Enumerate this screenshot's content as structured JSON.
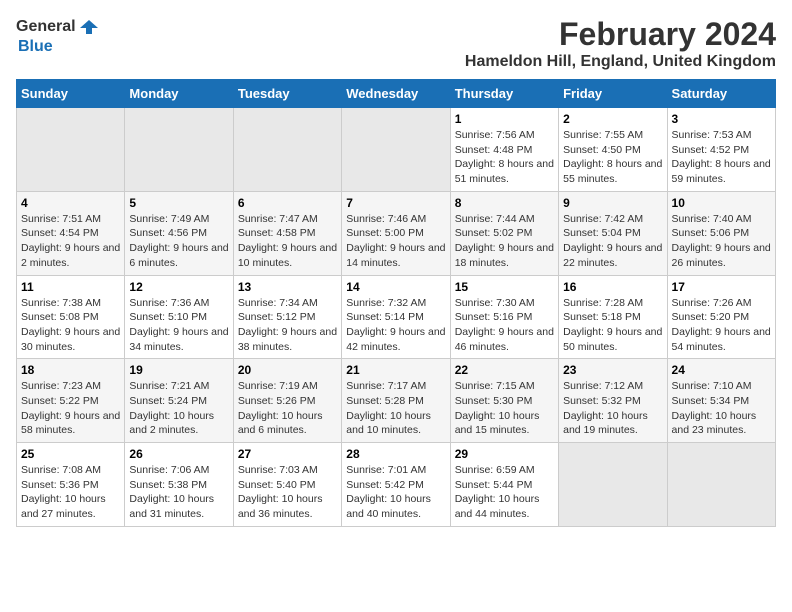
{
  "logo": {
    "general": "General",
    "blue": "Blue"
  },
  "title": "February 2024",
  "subtitle": "Hameldon Hill, England, United Kingdom",
  "days_of_week": [
    "Sunday",
    "Monday",
    "Tuesday",
    "Wednesday",
    "Thursday",
    "Friday",
    "Saturday"
  ],
  "weeks": [
    [
      {
        "day": null,
        "sunrise": null,
        "sunset": null,
        "daylight": null
      },
      {
        "day": null,
        "sunrise": null,
        "sunset": null,
        "daylight": null
      },
      {
        "day": null,
        "sunrise": null,
        "sunset": null,
        "daylight": null
      },
      {
        "day": null,
        "sunrise": null,
        "sunset": null,
        "daylight": null
      },
      {
        "day": "1",
        "sunrise": "Sunrise: 7:56 AM",
        "sunset": "Sunset: 4:48 PM",
        "daylight": "Daylight: 8 hours and 51 minutes."
      },
      {
        "day": "2",
        "sunrise": "Sunrise: 7:55 AM",
        "sunset": "Sunset: 4:50 PM",
        "daylight": "Daylight: 8 hours and 55 minutes."
      },
      {
        "day": "3",
        "sunrise": "Sunrise: 7:53 AM",
        "sunset": "Sunset: 4:52 PM",
        "daylight": "Daylight: 8 hours and 59 minutes."
      }
    ],
    [
      {
        "day": "4",
        "sunrise": "Sunrise: 7:51 AM",
        "sunset": "Sunset: 4:54 PM",
        "daylight": "Daylight: 9 hours and 2 minutes."
      },
      {
        "day": "5",
        "sunrise": "Sunrise: 7:49 AM",
        "sunset": "Sunset: 4:56 PM",
        "daylight": "Daylight: 9 hours and 6 minutes."
      },
      {
        "day": "6",
        "sunrise": "Sunrise: 7:47 AM",
        "sunset": "Sunset: 4:58 PM",
        "daylight": "Daylight: 9 hours and 10 minutes."
      },
      {
        "day": "7",
        "sunrise": "Sunrise: 7:46 AM",
        "sunset": "Sunset: 5:00 PM",
        "daylight": "Daylight: 9 hours and 14 minutes."
      },
      {
        "day": "8",
        "sunrise": "Sunrise: 7:44 AM",
        "sunset": "Sunset: 5:02 PM",
        "daylight": "Daylight: 9 hours and 18 minutes."
      },
      {
        "day": "9",
        "sunrise": "Sunrise: 7:42 AM",
        "sunset": "Sunset: 5:04 PM",
        "daylight": "Daylight: 9 hours and 22 minutes."
      },
      {
        "day": "10",
        "sunrise": "Sunrise: 7:40 AM",
        "sunset": "Sunset: 5:06 PM",
        "daylight": "Daylight: 9 hours and 26 minutes."
      }
    ],
    [
      {
        "day": "11",
        "sunrise": "Sunrise: 7:38 AM",
        "sunset": "Sunset: 5:08 PM",
        "daylight": "Daylight: 9 hours and 30 minutes."
      },
      {
        "day": "12",
        "sunrise": "Sunrise: 7:36 AM",
        "sunset": "Sunset: 5:10 PM",
        "daylight": "Daylight: 9 hours and 34 minutes."
      },
      {
        "day": "13",
        "sunrise": "Sunrise: 7:34 AM",
        "sunset": "Sunset: 5:12 PM",
        "daylight": "Daylight: 9 hours and 38 minutes."
      },
      {
        "day": "14",
        "sunrise": "Sunrise: 7:32 AM",
        "sunset": "Sunset: 5:14 PM",
        "daylight": "Daylight: 9 hours and 42 minutes."
      },
      {
        "day": "15",
        "sunrise": "Sunrise: 7:30 AM",
        "sunset": "Sunset: 5:16 PM",
        "daylight": "Daylight: 9 hours and 46 minutes."
      },
      {
        "day": "16",
        "sunrise": "Sunrise: 7:28 AM",
        "sunset": "Sunset: 5:18 PM",
        "daylight": "Daylight: 9 hours and 50 minutes."
      },
      {
        "day": "17",
        "sunrise": "Sunrise: 7:26 AM",
        "sunset": "Sunset: 5:20 PM",
        "daylight": "Daylight: 9 hours and 54 minutes."
      }
    ],
    [
      {
        "day": "18",
        "sunrise": "Sunrise: 7:23 AM",
        "sunset": "Sunset: 5:22 PM",
        "daylight": "Daylight: 9 hours and 58 minutes."
      },
      {
        "day": "19",
        "sunrise": "Sunrise: 7:21 AM",
        "sunset": "Sunset: 5:24 PM",
        "daylight": "Daylight: 10 hours and 2 minutes."
      },
      {
        "day": "20",
        "sunrise": "Sunrise: 7:19 AM",
        "sunset": "Sunset: 5:26 PM",
        "daylight": "Daylight: 10 hours and 6 minutes."
      },
      {
        "day": "21",
        "sunrise": "Sunrise: 7:17 AM",
        "sunset": "Sunset: 5:28 PM",
        "daylight": "Daylight: 10 hours and 10 minutes."
      },
      {
        "day": "22",
        "sunrise": "Sunrise: 7:15 AM",
        "sunset": "Sunset: 5:30 PM",
        "daylight": "Daylight: 10 hours and 15 minutes."
      },
      {
        "day": "23",
        "sunrise": "Sunrise: 7:12 AM",
        "sunset": "Sunset: 5:32 PM",
        "daylight": "Daylight: 10 hours and 19 minutes."
      },
      {
        "day": "24",
        "sunrise": "Sunrise: 7:10 AM",
        "sunset": "Sunset: 5:34 PM",
        "daylight": "Daylight: 10 hours and 23 minutes."
      }
    ],
    [
      {
        "day": "25",
        "sunrise": "Sunrise: 7:08 AM",
        "sunset": "Sunset: 5:36 PM",
        "daylight": "Daylight: 10 hours and 27 minutes."
      },
      {
        "day": "26",
        "sunrise": "Sunrise: 7:06 AM",
        "sunset": "Sunset: 5:38 PM",
        "daylight": "Daylight: 10 hours and 31 minutes."
      },
      {
        "day": "27",
        "sunrise": "Sunrise: 7:03 AM",
        "sunset": "Sunset: 5:40 PM",
        "daylight": "Daylight: 10 hours and 36 minutes."
      },
      {
        "day": "28",
        "sunrise": "Sunrise: 7:01 AM",
        "sunset": "Sunset: 5:42 PM",
        "daylight": "Daylight: 10 hours and 40 minutes."
      },
      {
        "day": "29",
        "sunrise": "Sunrise: 6:59 AM",
        "sunset": "Sunset: 5:44 PM",
        "daylight": "Daylight: 10 hours and 44 minutes."
      },
      {
        "day": null,
        "sunrise": null,
        "sunset": null,
        "daylight": null
      },
      {
        "day": null,
        "sunrise": null,
        "sunset": null,
        "daylight": null
      }
    ]
  ]
}
